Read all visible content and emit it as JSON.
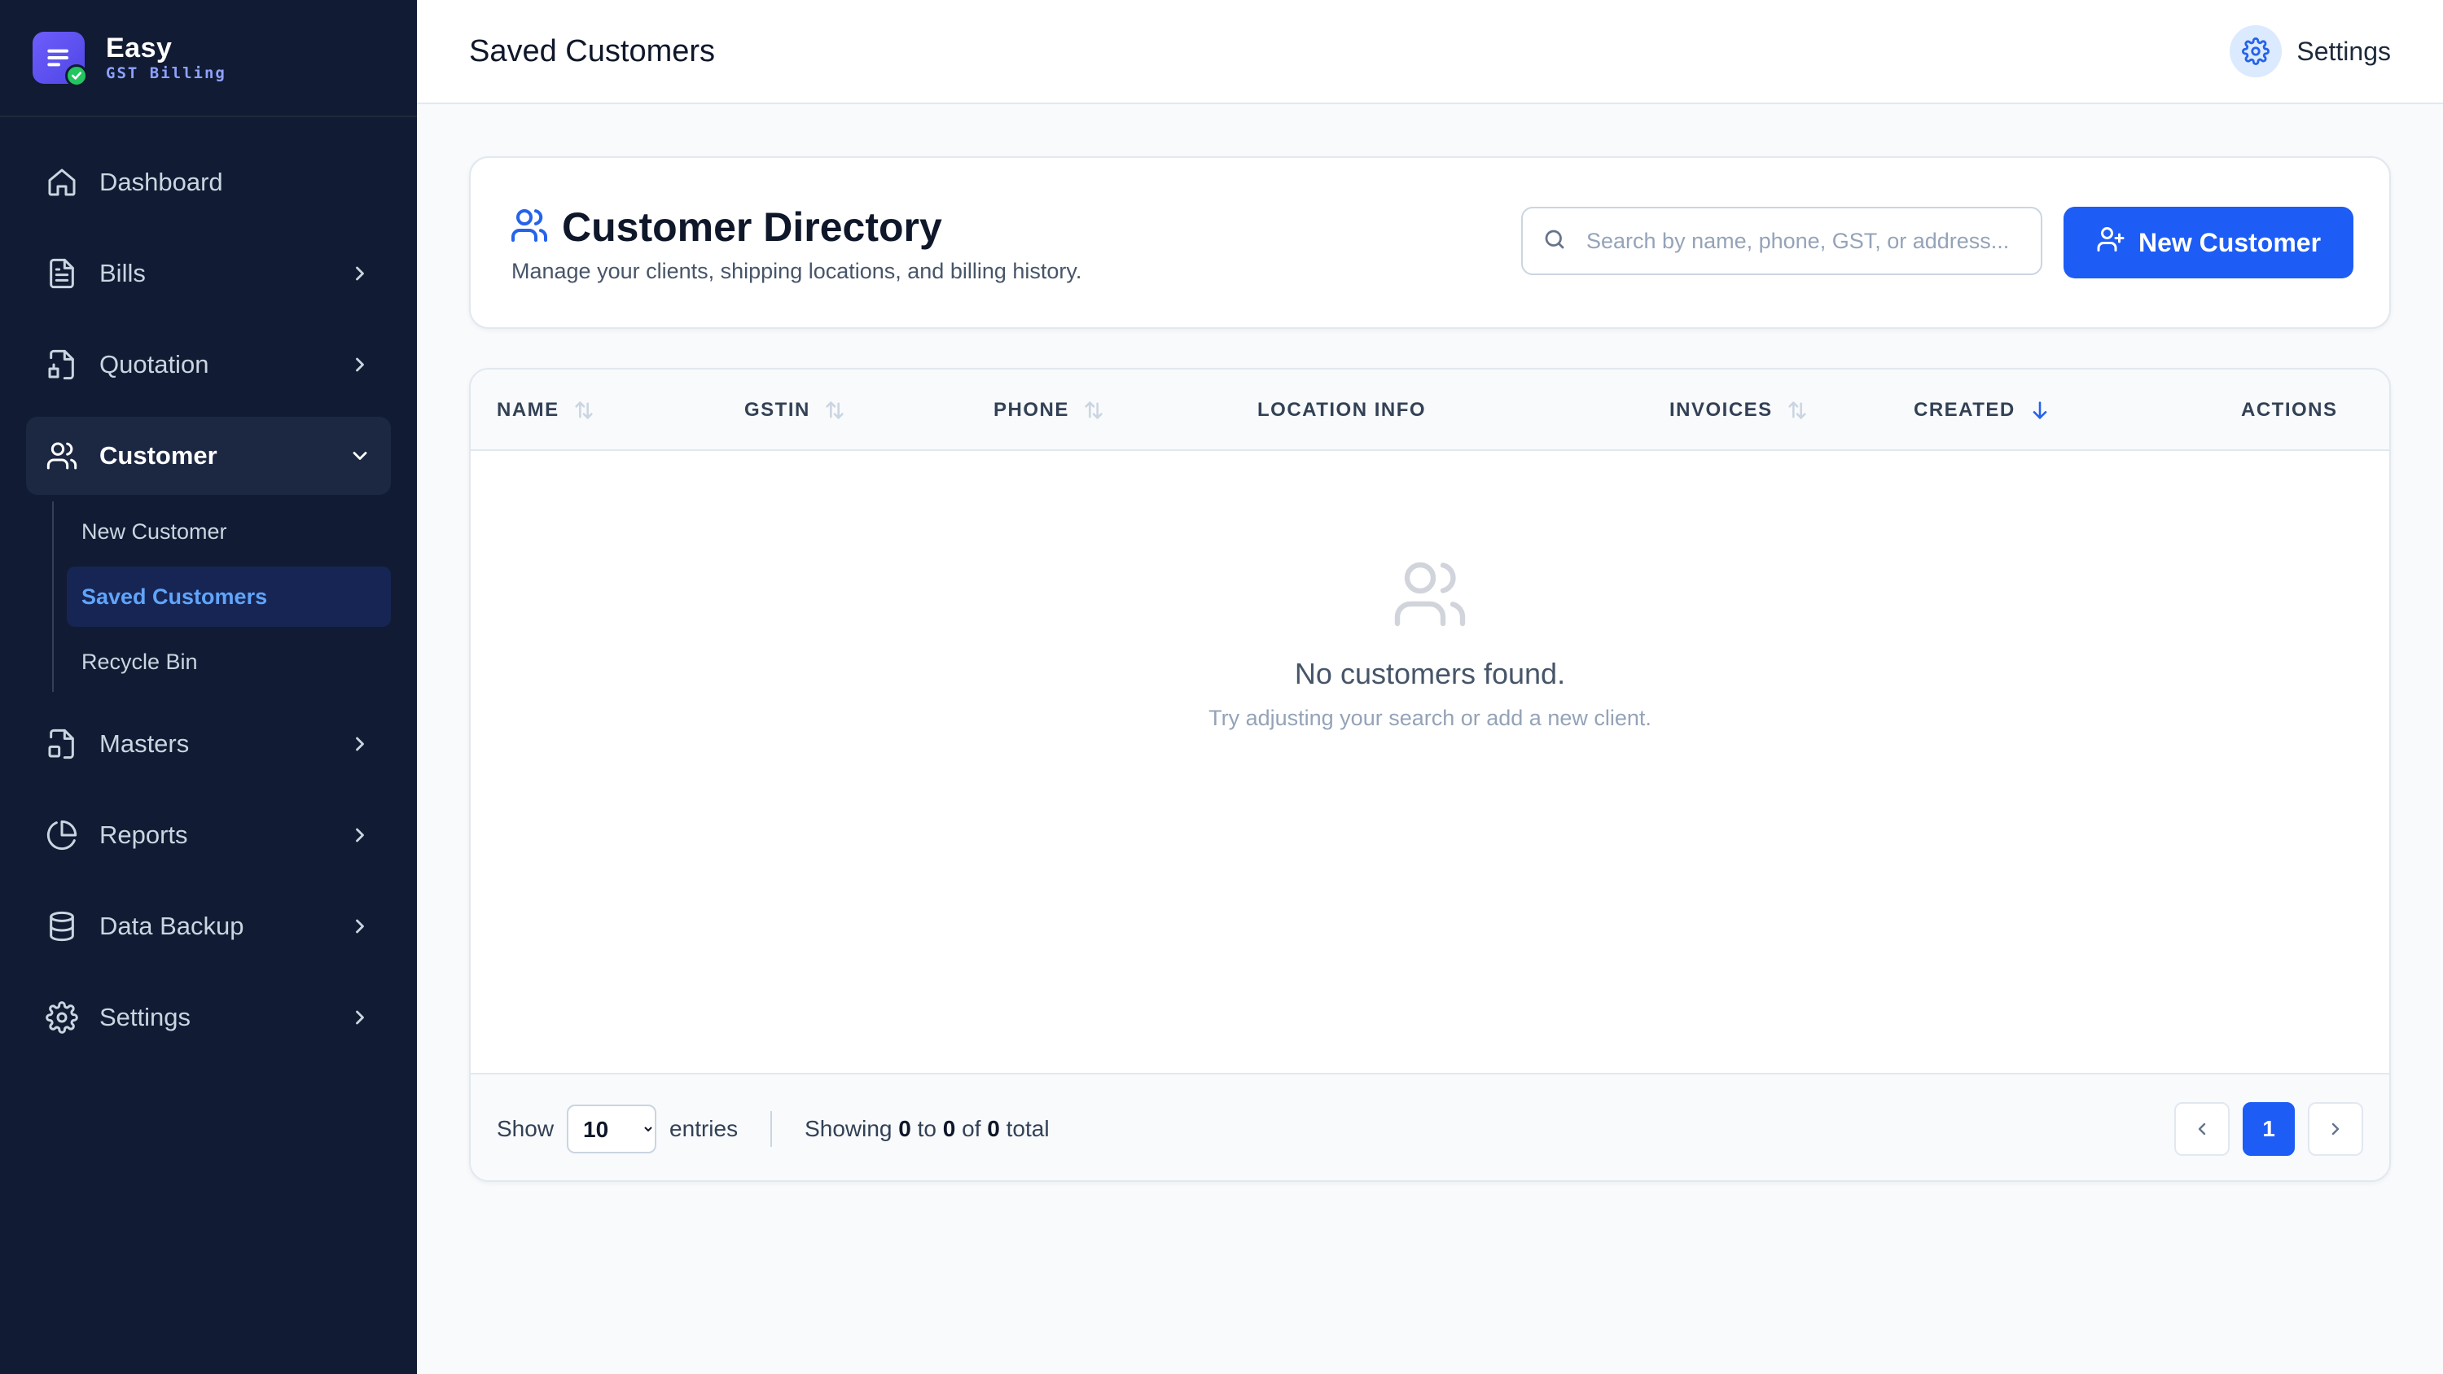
{
  "brand": {
    "name": "Easy",
    "subtitle": "GST Billing",
    "logo_icon": "document-check-icon"
  },
  "sidebar": {
    "items": [
      {
        "label": "Dashboard",
        "icon": "home-icon",
        "chevron": false
      },
      {
        "label": "Bills",
        "icon": "document-icon",
        "chevron": "right"
      },
      {
        "label": "Quotation",
        "icon": "quotation-icon",
        "chevron": "right"
      },
      {
        "label": "Customer",
        "icon": "users-icon",
        "chevron": "down",
        "active": true,
        "children": [
          {
            "label": "New Customer"
          },
          {
            "label": "Saved Customers",
            "active": true
          },
          {
            "label": "Recycle Bin"
          }
        ]
      },
      {
        "label": "Masters",
        "icon": "masters-icon",
        "chevron": "right"
      },
      {
        "label": "Reports",
        "icon": "pie-chart-icon",
        "chevron": "right"
      },
      {
        "label": "Data Backup",
        "icon": "database-icon",
        "chevron": "right"
      },
      {
        "label": "Settings",
        "icon": "gear-icon",
        "chevron": "right"
      }
    ]
  },
  "topbar": {
    "title": "Saved Customers",
    "settings_label": "Settings"
  },
  "directory": {
    "title": "Customer Directory",
    "subtitle": "Manage your clients, shipping locations, and billing history.",
    "search_placeholder": "Search by name, phone, GST, or address...",
    "new_button": "New Customer"
  },
  "table": {
    "columns": [
      {
        "label": "NAME",
        "sort": "sortable"
      },
      {
        "label": "GSTIN",
        "sort": "sortable"
      },
      {
        "label": "PHONE",
        "sort": "sortable"
      },
      {
        "label": "LOCATION INFO",
        "sort": "none"
      },
      {
        "label": "INVOICES",
        "sort": "sortable"
      },
      {
        "label": "CREATED",
        "sort": "desc"
      },
      {
        "label": "ACTIONS",
        "sort": "none"
      }
    ],
    "rows": [],
    "empty_title": "No customers found.",
    "empty_subtitle": "Try adjusting your search or add a new client."
  },
  "footer": {
    "show_label": "Show",
    "page_size": "10",
    "page_size_options": [
      "10"
    ],
    "entries_label": "entries",
    "showing_prefix": "Showing",
    "from": "0",
    "to_label": "to",
    "to": "0",
    "of_label": "of",
    "total": "0",
    "total_label": "total",
    "current_page": "1"
  },
  "colors": {
    "sidebar_bg": "#111b33",
    "accent": "#1d5cf5",
    "active_sub_text": "#60a5fa"
  }
}
